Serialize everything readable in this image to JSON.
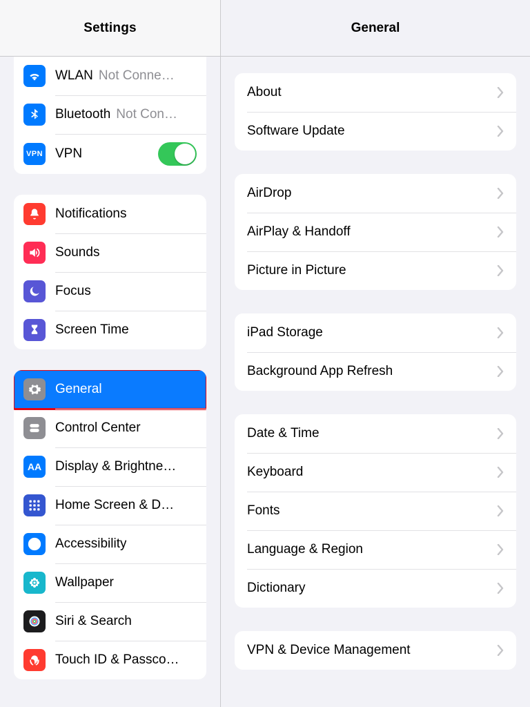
{
  "sidebar": {
    "title": "Settings",
    "groups": [
      {
        "items": [
          {
            "id": "wlan",
            "label": "WLAN",
            "status": "Not Conne…",
            "icon": "wifi",
            "icon_bg": "#007aff"
          },
          {
            "id": "bluetooth",
            "label": "Bluetooth",
            "status": "Not Con…",
            "icon": "bluetooth",
            "icon_bg": "#007aff"
          },
          {
            "id": "vpn",
            "label": "VPN",
            "switch_on": true,
            "icon": "vpn",
            "icon_bg": "#007aff"
          }
        ]
      },
      {
        "items": [
          {
            "id": "notifications",
            "label": "Notifications",
            "icon": "bell",
            "icon_bg": "#ff3b30"
          },
          {
            "id": "sounds",
            "label": "Sounds",
            "icon": "speaker",
            "icon_bg": "#ff2d55"
          },
          {
            "id": "focus",
            "label": "Focus",
            "icon": "moon",
            "icon_bg": "#5856d6"
          },
          {
            "id": "screentime",
            "label": "Screen Time",
            "icon": "hourglass",
            "icon_bg": "#5856d6"
          }
        ]
      },
      {
        "items": [
          {
            "id": "general",
            "label": "General",
            "icon": "gear",
            "icon_bg": "#8e8e93",
            "selected": true,
            "highlight": true
          },
          {
            "id": "controlcenter",
            "label": "Control Center",
            "icon": "switches",
            "icon_bg": "#8e8e93"
          },
          {
            "id": "display",
            "label": "Display & Brightne…",
            "icon": "aa",
            "icon_bg": "#007aff"
          },
          {
            "id": "homescreen",
            "label": "Home Screen & D…",
            "icon": "grid",
            "icon_bg": "#3456d0"
          },
          {
            "id": "accessibility",
            "label": "Accessibility",
            "icon": "person",
            "icon_bg": "#007aff"
          },
          {
            "id": "wallpaper",
            "label": "Wallpaper",
            "icon": "flower",
            "icon_bg": "#18b7cc"
          },
          {
            "id": "siri",
            "label": "Siri & Search",
            "icon": "siri",
            "icon_bg": "#1c1c1e"
          },
          {
            "id": "touchid",
            "label": "Touch ID & Passco…",
            "icon": "fingerprint",
            "icon_bg": "#ff3b30"
          }
        ]
      }
    ]
  },
  "detail": {
    "title": "General",
    "groups": [
      {
        "items": [
          {
            "label": "About"
          },
          {
            "label": "Software Update"
          }
        ]
      },
      {
        "items": [
          {
            "label": "AirDrop"
          },
          {
            "label": "AirPlay & Handoff"
          },
          {
            "label": "Picture in Picture"
          }
        ]
      },
      {
        "items": [
          {
            "label": "iPad Storage"
          },
          {
            "label": "Background App Refresh"
          }
        ]
      },
      {
        "items": [
          {
            "label": "Date & Time"
          },
          {
            "label": "Keyboard"
          },
          {
            "label": "Fonts"
          },
          {
            "label": "Language & Region"
          },
          {
            "label": "Dictionary"
          }
        ]
      },
      {
        "items": [
          {
            "label": "VPN & Device Management"
          }
        ]
      }
    ]
  }
}
